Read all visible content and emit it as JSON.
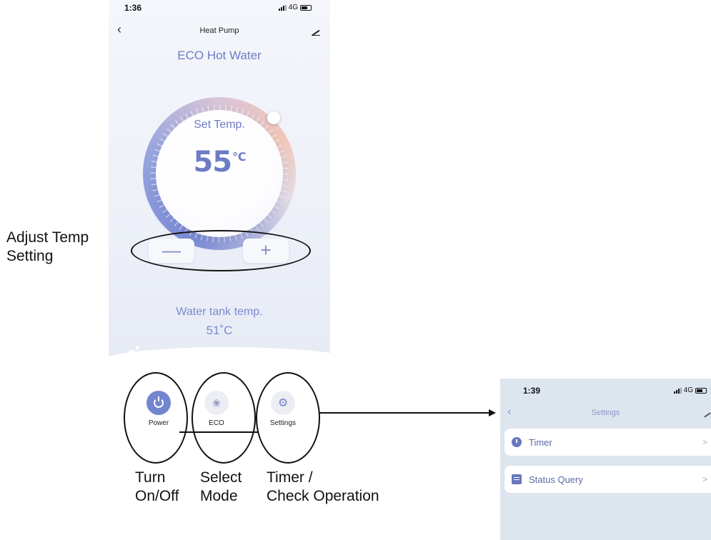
{
  "main_screen": {
    "status_time": "1:36",
    "network": "4G",
    "title": "Heat Pump",
    "mode_title": "ECO Hot Water",
    "set_temp_label": "Set Temp.",
    "set_temp_value": "55",
    "set_temp_unit": "℃",
    "minus_label": "—",
    "plus_label": "+",
    "tank_label": "Water tank temp.",
    "tank_value": "51˚C",
    "actions": [
      {
        "label": "Power",
        "icon": "power-icon"
      },
      {
        "label": "ECO",
        "icon": "lotus-icon"
      },
      {
        "label": "Settings",
        "icon": "gear-icon"
      }
    ],
    "accent_color": "#7385cf"
  },
  "annotations": {
    "adjust": [
      "Adjust Temp",
      "Setting"
    ],
    "turn": [
      "Turn",
      "On/Off"
    ],
    "select": [
      "Select",
      "Mode"
    ],
    "timer": [
      "Timer /",
      "Check Operation"
    ]
  },
  "settings_screen": {
    "status_time": "1:39",
    "network": "4G",
    "title": "Settings",
    "items": [
      {
        "label": "Timer",
        "icon": "clock-icon"
      },
      {
        "label": "Status Query",
        "icon": "document-icon"
      }
    ]
  }
}
